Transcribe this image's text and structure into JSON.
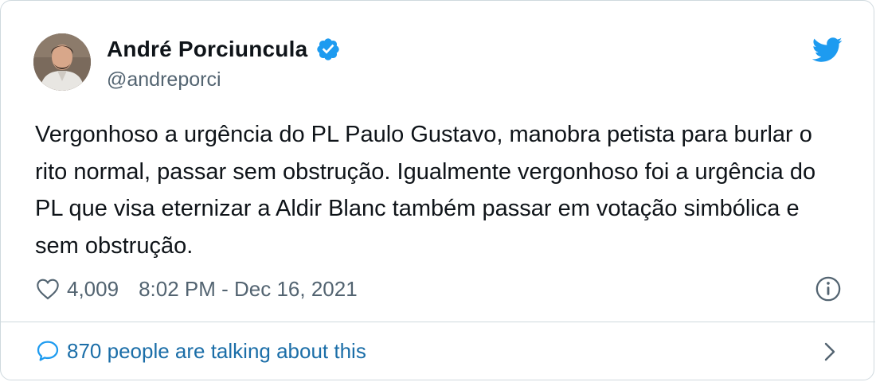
{
  "author": {
    "name": "André Porciuncula",
    "handle": "@andreporci",
    "verified": true,
    "avatar": "avatar-photo"
  },
  "tweet": {
    "text": "Vergonhoso a urgência do PL Paulo Gustavo, manobra petista para burlar o rito normal, passar sem obstrução. Igualmente vergonhoso foi a urgência do PL que visa eternizar a Aldir Blanc também passar em votação simbólica e sem obstrução."
  },
  "meta": {
    "likes": "4,009",
    "timestamp": "8:02 PM - Dec 16, 2021"
  },
  "footer": {
    "talking": "870 people are talking about this"
  },
  "icons": {
    "logo": "twitter-bird-icon",
    "verified": "verified-badge-icon",
    "like": "heart-icon",
    "info": "info-icon",
    "reply": "speech-bubble-icon",
    "more": "chevron-right-icon"
  },
  "colors": {
    "accent": "#1d9bf0",
    "link": "#1b6ea8",
    "text": "#0f1419",
    "muted": "#536471",
    "border": "#cfd9de"
  }
}
